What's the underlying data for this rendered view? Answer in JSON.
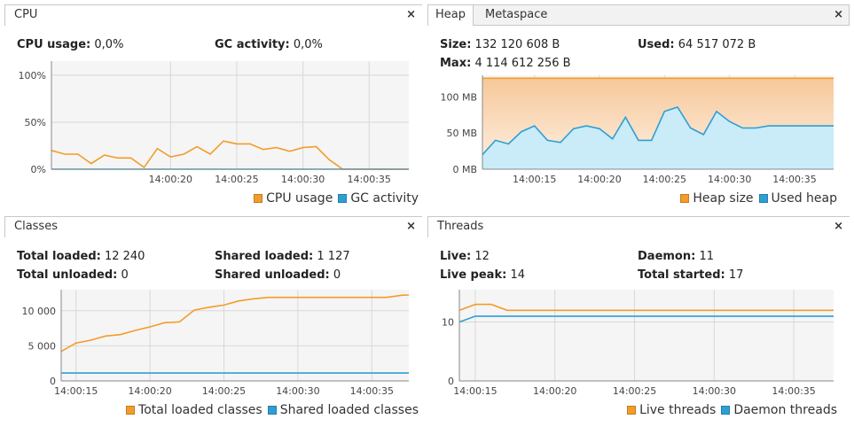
{
  "colors": {
    "orange": "#f39c2a",
    "blue": "#2e9fd3",
    "heap_fill_top": "#f7c89a",
    "heap_fill_bottom": "#fdf1e4",
    "used_fill": "#c9ecf8",
    "grid": "#d8d8d8",
    "plot_bg": "#f5f5f5"
  },
  "cpu": {
    "title": "CPU",
    "close": "×",
    "usage_label": "CPU usage:",
    "usage_value": "0,0%",
    "gc_label": "GC activity:",
    "gc_value": "0,0%",
    "legend": [
      {
        "label": "CPU usage",
        "color": "#f39c2a"
      },
      {
        "label": "GC activity",
        "color": "#2e9fd3"
      }
    ]
  },
  "heap": {
    "tabs": [
      "Heap",
      "Metaspace"
    ],
    "close": "×",
    "size_label": "Size:",
    "size_value": "132 120 608 B",
    "used_label": "Used:",
    "used_value": "64 517 072 B",
    "max_label": "Max:",
    "max_value": "4 114 612 256 B",
    "legend": [
      {
        "label": "Heap size",
        "color": "#f39c2a"
      },
      {
        "label": "Used heap",
        "color": "#2e9fd3"
      }
    ]
  },
  "classes": {
    "title": "Classes",
    "close": "×",
    "total_loaded_label": "Total loaded:",
    "total_loaded_value": "12 240",
    "shared_loaded_label": "Shared loaded:",
    "shared_loaded_value": "1 127",
    "total_unloaded_label": "Total unloaded:",
    "total_unloaded_value": "0",
    "shared_unloaded_label": "Shared unloaded:",
    "shared_unloaded_value": "0",
    "legend": [
      {
        "label": "Total loaded classes",
        "color": "#f39c2a"
      },
      {
        "label": "Shared loaded classes",
        "color": "#2e9fd3"
      }
    ]
  },
  "threads": {
    "title": "Threads",
    "close": "×",
    "live_label": "Live:",
    "live_value": "12",
    "daemon_label": "Daemon:",
    "daemon_value": "11",
    "peak_label": "Live peak:",
    "peak_value": "14",
    "started_label": "Total started:",
    "started_value": "17",
    "legend": [
      {
        "label": "Live threads",
        "color": "#f39c2a"
      },
      {
        "label": "Daemon threads",
        "color": "#2e9fd3"
      }
    ]
  },
  "chart_data": [
    {
      "id": "cpu",
      "type": "line",
      "x_unit": "seconds after 14:00:11",
      "xlim": [
        11,
        38
      ],
      "ylim": [
        0,
        115
      ],
      "xticks": [
        {
          "x": 20,
          "label": "14:00:20"
        },
        {
          "x": 25,
          "label": "14:00:25"
        },
        {
          "x": 30,
          "label": "14:00:30"
        },
        {
          "x": 35,
          "label": "14:00:35"
        }
      ],
      "yticks": [
        {
          "y": 0,
          "label": "0%"
        },
        {
          "y": 50,
          "label": "50%"
        },
        {
          "y": 100,
          "label": "100%"
        }
      ],
      "series": [
        {
          "name": "CPU usage",
          "color": "#f39c2a",
          "fill": false,
          "x": [
            11,
            12,
            13,
            14,
            15,
            16,
            17,
            18,
            19,
            20,
            21,
            22,
            23,
            24,
            25,
            26,
            27,
            28,
            29,
            30,
            31,
            32,
            33,
            34,
            35,
            36,
            37,
            38
          ],
          "y": [
            20,
            16,
            16,
            6,
            15,
            12,
            12,
            2,
            22,
            13,
            16,
            24,
            16,
            30,
            27,
            27,
            21,
            23,
            19,
            23,
            24,
            10,
            0,
            0,
            0,
            0,
            0,
            0
          ]
        },
        {
          "name": "GC activity",
          "color": "#2e9fd3",
          "fill": false,
          "x": [
            11,
            38
          ],
          "y": [
            0,
            0
          ]
        }
      ]
    },
    {
      "id": "heap",
      "type": "area",
      "xlim": [
        11,
        38
      ],
      "ylim": [
        0,
        130
      ],
      "xticks": [
        {
          "x": 15,
          "label": "14:00:15"
        },
        {
          "x": 20,
          "label": "14:00:20"
        },
        {
          "x": 25,
          "label": "14:00:25"
        },
        {
          "x": 30,
          "label": "14:00:30"
        },
        {
          "x": 35,
          "label": "14:00:35"
        }
      ],
      "yticks": [
        {
          "y": 0,
          "label": "0 MB"
        },
        {
          "y": 50,
          "label": "50 MB"
        },
        {
          "y": 100,
          "label": "100 MB"
        }
      ],
      "series": [
        {
          "name": "Heap size",
          "color": "#f39c2a",
          "fill": true,
          "x": [
            11,
            38
          ],
          "y": [
            126,
            126
          ]
        },
        {
          "name": "Used heap",
          "color": "#2e9fd3",
          "fill": true,
          "x": [
            11,
            12,
            13,
            14,
            15,
            16,
            17,
            18,
            19,
            20,
            21,
            22,
            23,
            24,
            25,
            26,
            27,
            28,
            29,
            30,
            31,
            32,
            33,
            34,
            35,
            36,
            37,
            38
          ],
          "y": [
            20,
            40,
            35,
            52,
            60,
            40,
            37,
            56,
            60,
            56,
            42,
            72,
            40,
            40,
            80,
            86,
            57,
            48,
            80,
            66,
            57,
            57,
            60,
            60,
            60,
            60,
            60,
            60
          ]
        }
      ]
    },
    {
      "id": "classes",
      "type": "line",
      "xlim": [
        14,
        37.5
      ],
      "ylim": [
        0,
        13000
      ],
      "xticks": [
        {
          "x": 15,
          "label": "14:00:15"
        },
        {
          "x": 20,
          "label": "14:00:20"
        },
        {
          "x": 25,
          "label": "14:00:25"
        },
        {
          "x": 30,
          "label": "14:00:30"
        },
        {
          "x": 35,
          "label": "14:00:35"
        }
      ],
      "yticks": [
        {
          "y": 0,
          "label": "0"
        },
        {
          "y": 5000,
          "label": "5 000"
        },
        {
          "y": 10000,
          "label": "10 000"
        }
      ],
      "series": [
        {
          "name": "Total loaded classes",
          "color": "#f39c2a",
          "fill": false,
          "x": [
            14,
            15,
            16,
            17,
            18,
            19,
            20,
            21,
            22,
            23,
            24,
            25,
            26,
            27,
            28,
            29,
            30,
            31,
            32,
            33,
            34,
            35,
            36,
            37,
            37.5
          ],
          "y": [
            4200,
            5400,
            5800,
            6400,
            6600,
            7200,
            7700,
            8300,
            8400,
            10100,
            10500,
            10800,
            11400,
            11700,
            11900,
            11900,
            11900,
            11900,
            11900,
            11900,
            11900,
            11900,
            11900,
            12200,
            12240
          ]
        },
        {
          "name": "Shared loaded classes",
          "color": "#2e9fd3",
          "fill": false,
          "x": [
            14,
            37.5
          ],
          "y": [
            1127,
            1127
          ]
        }
      ]
    },
    {
      "id": "threads",
      "type": "line",
      "xlim": [
        14,
        37.5
      ],
      "ylim": [
        0,
        15.5
      ],
      "xticks": [
        {
          "x": 15,
          "label": "14:00:15"
        },
        {
          "x": 20,
          "label": "14:00:20"
        },
        {
          "x": 25,
          "label": "14:00:25"
        },
        {
          "x": 30,
          "label": "14:00:30"
        },
        {
          "x": 35,
          "label": "14:00:35"
        }
      ],
      "yticks": [
        {
          "y": 0,
          "label": "0"
        },
        {
          "y": 10,
          "label": "10"
        }
      ],
      "series": [
        {
          "name": "Live threads",
          "color": "#f39c2a",
          "fill": false,
          "x": [
            14,
            15,
            16,
            17,
            37.5
          ],
          "y": [
            12,
            13,
            13,
            12,
            12
          ]
        },
        {
          "name": "Daemon threads",
          "color": "#2e9fd3",
          "fill": false,
          "x": [
            14,
            15,
            37.5
          ],
          "y": [
            10,
            11,
            11
          ]
        }
      ]
    }
  ]
}
